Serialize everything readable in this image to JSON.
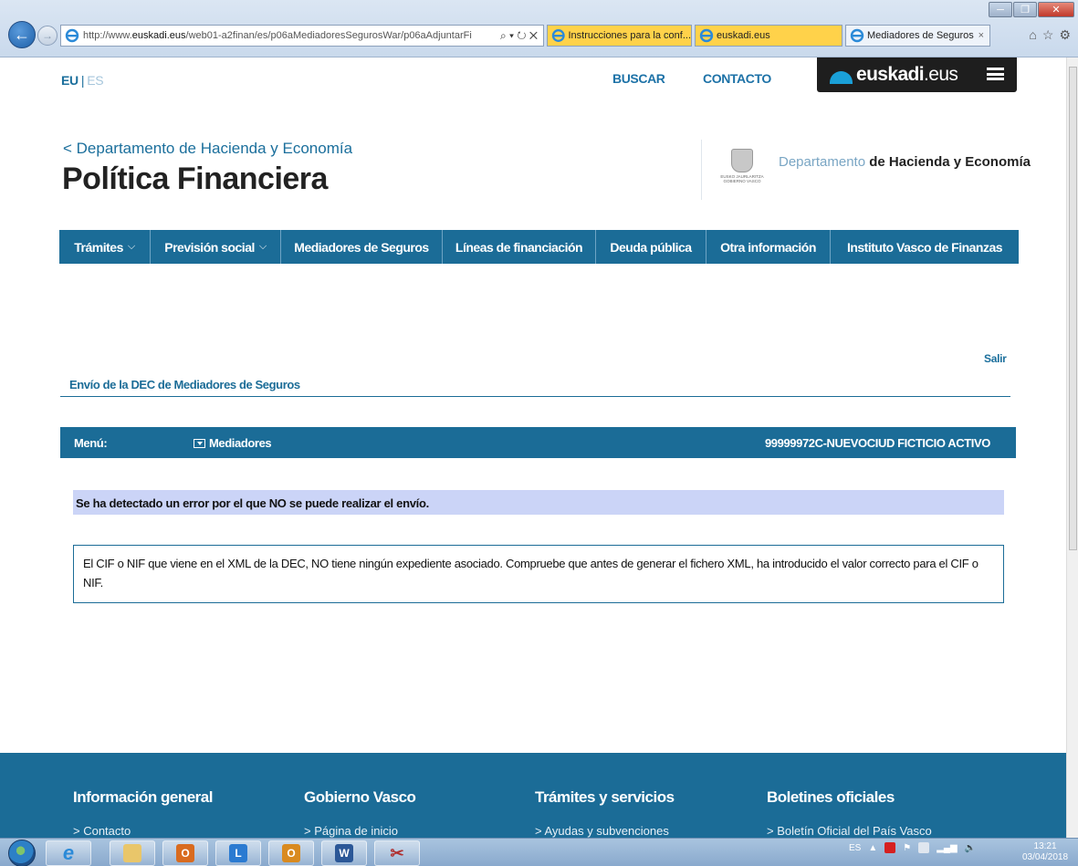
{
  "browser": {
    "url_prefix": "http://www.",
    "url_domain": "euskadi.eus",
    "url_path": "/web01-a2finan/es/p06aMediadoresSegurosWar/p06aAdjuntarFi",
    "address_buttons": "⌕ ▾ ↻ ✕",
    "tabs": [
      {
        "title": "Instrucciones para la conf..."
      },
      {
        "title": "euskadi.eus"
      },
      {
        "title": "Mediadores de Seguros",
        "close": "×"
      }
    ]
  },
  "header": {
    "lang_current": "EU",
    "lang_sep": "|",
    "lang_other": "ES",
    "buscar": "BUSCAR",
    "contacto": "CONTACTO",
    "logo_brand": "euskadi",
    "logo_tld": ".eus",
    "dept_back": "< Departamento de Hacienda y Economía",
    "site_title": "Política Financiera",
    "seal_text": "EUSKO JAURLARITZA GOBIERNO VASCO",
    "dept_light": "Departamento",
    "dept_bold": "de Hacienda y Economía"
  },
  "nav": [
    {
      "label": "Trámites",
      "chevron": "⌵"
    },
    {
      "label": "Previsión social",
      "chevron": "⌵"
    },
    {
      "label": "Mediadores de Seguros",
      "chevron": ""
    },
    {
      "label": "Líneas de financiación",
      "chevron": ""
    },
    {
      "label": "Deuda pública",
      "chevron": ""
    },
    {
      "label": "Otra información",
      "chevron": ""
    },
    {
      "label": "Instituto Vasco de Finanzas",
      "chevron": ""
    }
  ],
  "content": {
    "salir": "Salir",
    "section_title": "Envío de la DEC de Mediadores de Seguros",
    "menu_label": "Menú:",
    "menu_dropdown": "Mediadores",
    "menu_user": "99999972C-NUEVOCIUD FICTICIO ACTIVO",
    "error_heading": "Se ha detectado un error por el que NO se puede realizar el envío.",
    "error_message": "El CIF o NIF que viene en el XML de la DEC, NO tiene ningún expediente asociado. Compruebe que antes de generar el fichero XML, ha introducido el valor correcto para el CIF o NIF."
  },
  "footer": [
    {
      "heading": "Información general",
      "link": "> Contacto"
    },
    {
      "heading": "Gobierno Vasco",
      "link": "> Página de inicio"
    },
    {
      "heading": "Trámites y servicios",
      "link": "> Ayudas y subvenciones"
    },
    {
      "heading": "Boletines oficiales",
      "link": "> Boletín Oficial del País Vasco"
    }
  ],
  "taskbar": {
    "lang": "ES",
    "time": "13:21",
    "date": "03/04/2018"
  },
  "colors": {
    "brand_blue": "#1b6c97",
    "error_bg": "#cbd4f7"
  }
}
